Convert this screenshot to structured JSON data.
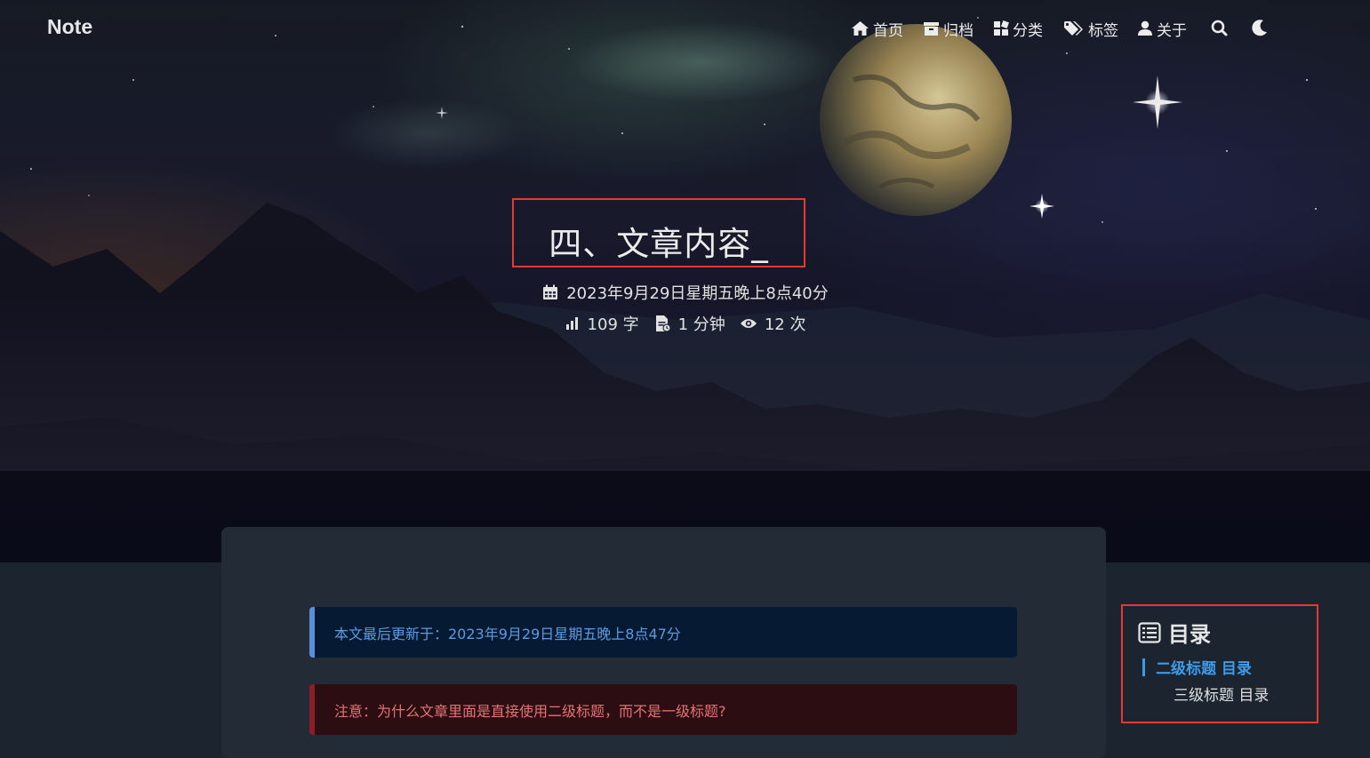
{
  "brand": "Note",
  "nav": {
    "items": [
      {
        "label": "首页",
        "icon": "home-icon"
      },
      {
        "label": "归档",
        "icon": "archive-icon"
      },
      {
        "label": "分类",
        "icon": "category-icon"
      },
      {
        "label": "标签",
        "icon": "tags-icon"
      },
      {
        "label": "关于",
        "icon": "user-icon"
      }
    ],
    "search_icon": "search-icon",
    "theme_icon": "moon-icon"
  },
  "post": {
    "title": "四、文章内容_",
    "date": "2023年9月29日星期五晚上8点40分",
    "word_count": "109 字",
    "read_time": "1 分钟",
    "views": "12 次"
  },
  "content": {
    "info_note": "本文最后更新于：2023年9月29日星期五晚上8点47分",
    "danger_note": "注意：为什么文章里面是直接使用二级标题，而不是一级标题?"
  },
  "toc": {
    "title": "目录",
    "items": [
      "二级标题 目录",
      "三级标题 目录"
    ]
  },
  "colors": {
    "accent_blue": "#3d9be9",
    "highlight_red": "#e53935",
    "info_bg": "#071a33",
    "danger_bg": "#2c0d12"
  }
}
